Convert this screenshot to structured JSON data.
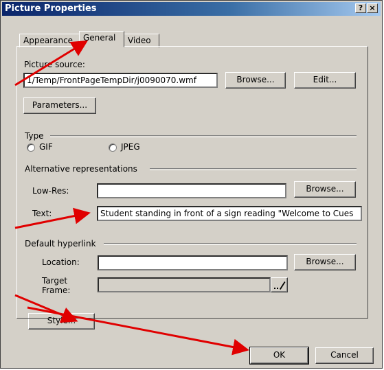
{
  "window": {
    "title": "Picture Properties",
    "help_label": "?",
    "close_label": "×"
  },
  "tabs": [
    {
      "label": "Appearance"
    },
    {
      "label": "General"
    },
    {
      "label": "Video"
    }
  ],
  "general": {
    "picture_source_label": "Picture source:",
    "picture_source_value": "1/Temp/FrontPageTempDir/j0090070.wmf",
    "browse_label": "Browse...",
    "edit_label": "Edit...",
    "parameters_label": "Parameters..."
  },
  "type": {
    "label": "Type",
    "gif_label": "GIF",
    "jpeg_label": "JPEG"
  },
  "alternative": {
    "label": "Alternative representations",
    "lowres_label": "Low-Res:",
    "lowres_value": "",
    "browse_label": "Browse...",
    "text_label": "Text:",
    "text_value": "Student standing in front of a sign reading \"Welcome to Cues"
  },
  "hyperlink": {
    "label": "Default hyperlink",
    "location_label": "Location:",
    "location_value": "",
    "browse_label": "Browse...",
    "target_label_1": "Target",
    "target_label_2": "Frame:",
    "target_value": "",
    "style_label": "Style..."
  },
  "footer": {
    "ok_label": "OK",
    "cancel_label": "Cancel"
  },
  "annotation": {
    "arrow_color": "#e00000"
  }
}
